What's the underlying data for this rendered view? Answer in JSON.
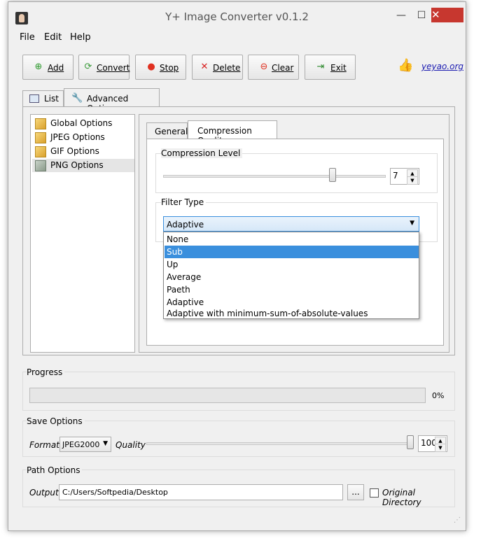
{
  "window": {
    "title": "Y+ Image Converter v0.1.2",
    "close_glyph": "✕",
    "minimize_glyph": "—",
    "maximize_glyph": "☐"
  },
  "menu": [
    "File",
    "Edit",
    "Help"
  ],
  "toolbar": {
    "add": "Add",
    "convert": "Convert",
    "stop": "Stop",
    "delete": "Delete",
    "clear": "Clear",
    "exit": "Exit",
    "link": "yeyao.org"
  },
  "main_tabs": [
    "List",
    "Advanced Options"
  ],
  "options_list": [
    "Global Options",
    "JPEG Options",
    "GIF Options",
    "PNG Options"
  ],
  "png_tabs": [
    "General",
    "Compression Quality"
  ],
  "compression": {
    "label": "Compression Level",
    "value": "7",
    "slider_fraction": 0.77
  },
  "filter": {
    "label": "Filter Type",
    "selected": "Adaptive",
    "options": [
      "None",
      "Sub",
      "Up",
      "Average",
      "Paeth",
      "Adaptive",
      "Adaptive with minimum-sum-of-absolute-values"
    ],
    "highlighted": "Sub"
  },
  "progress": {
    "label": "Progress",
    "percent_text": "0%",
    "value": 0
  },
  "save": {
    "label": "Save Options",
    "format_label": "Format",
    "format_value": "JPEG2000",
    "quality_label": "Quality",
    "quality_value": "100",
    "quality_fraction": 1.0
  },
  "path": {
    "label": "Path Options",
    "output_label": "Output",
    "output_value": "C:/Users/Softpedia/Desktop",
    "browse": "...",
    "original_dir": "Original Directory"
  },
  "colors": {
    "accent": "#3a8fdd",
    "close": "#c7372f"
  }
}
